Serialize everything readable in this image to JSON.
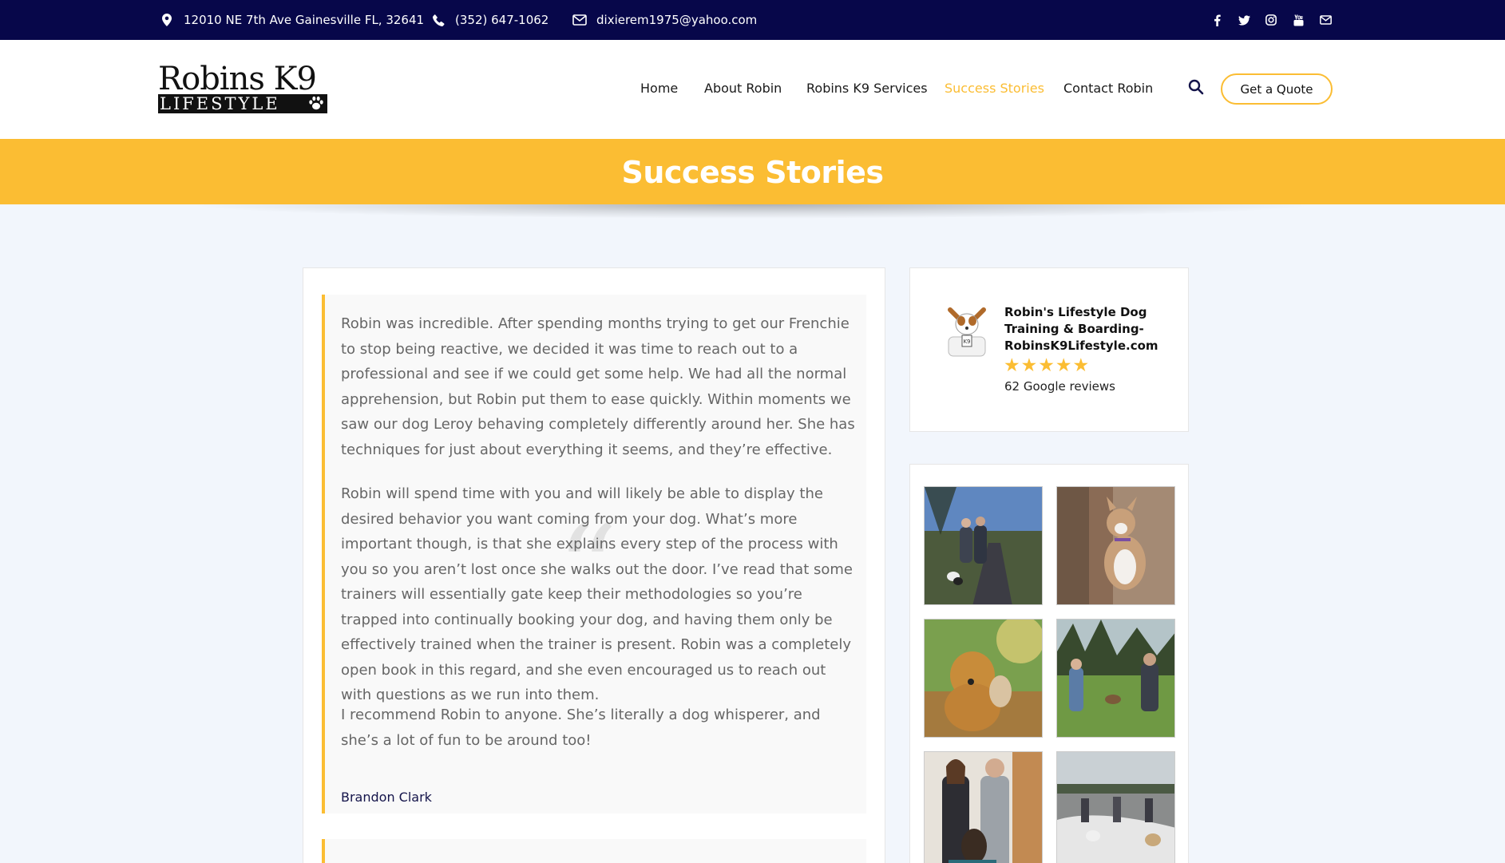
{
  "topbar": {
    "address": "12010 NE 7th Ave Gainesville FL, 32641",
    "phone": "(352) 647-1062",
    "email": "dixierem1975@yahoo.com",
    "social_icons": [
      "facebook-icon",
      "twitter-icon",
      "instagram-icon",
      "youtube-icon",
      "mail-icon"
    ]
  },
  "header": {
    "logo_line1": "Robins K9",
    "logo_line2": "LIFESTYLE",
    "nav": [
      {
        "label": "Home"
      },
      {
        "label": "About Robin"
      },
      {
        "label": "Robins K9 Services"
      },
      {
        "label": "Success Stories",
        "active": true
      },
      {
        "label": "Contact Robin"
      }
    ],
    "quote_button": "Get a Quote"
  },
  "banner": {
    "title": "Success Stories"
  },
  "testimonials": [
    {
      "paragraphs": [
        "Robin was incredible. After spending months trying to get our Frenchie to stop being reactive, we decided it was time to reach out to a professional and see if we could get some help. We had all the normal apprehension, but Robin put them to ease quickly. Within moments we saw our dog Leroy behaving completely differently around her. She has techniques for just about everything it seems, and they’re effective.",
        "Robin will spend time with you and will likely be able to display the desired behavior you want coming from your dog. What’s more important though, is that she explains every step of the process with you so you aren’t lost once she walks out the door. I’ve read that some trainers will essentially gate keep their methodologies so you’re trapped into continually booking your dog, and having them only be effectively trained when the trainer is present. Robin was a completely open book in this regard, and she even encouraged us to reach out with questions as we run into them.",
        "I recommend Robin to anyone. She’s literally a dog whisperer, and she’s a lot of fun to be around too!"
      ],
      "author": "Brandon Clark"
    }
  ],
  "review_widget": {
    "business_name": "Robin's Lifestyle Dog Training & Boarding- RobinsK9Lifestyle.com",
    "rating": 5,
    "count_text": "62 Google reviews"
  },
  "colors": {
    "accent": "#fbbd33",
    "navy": "#07074a"
  }
}
